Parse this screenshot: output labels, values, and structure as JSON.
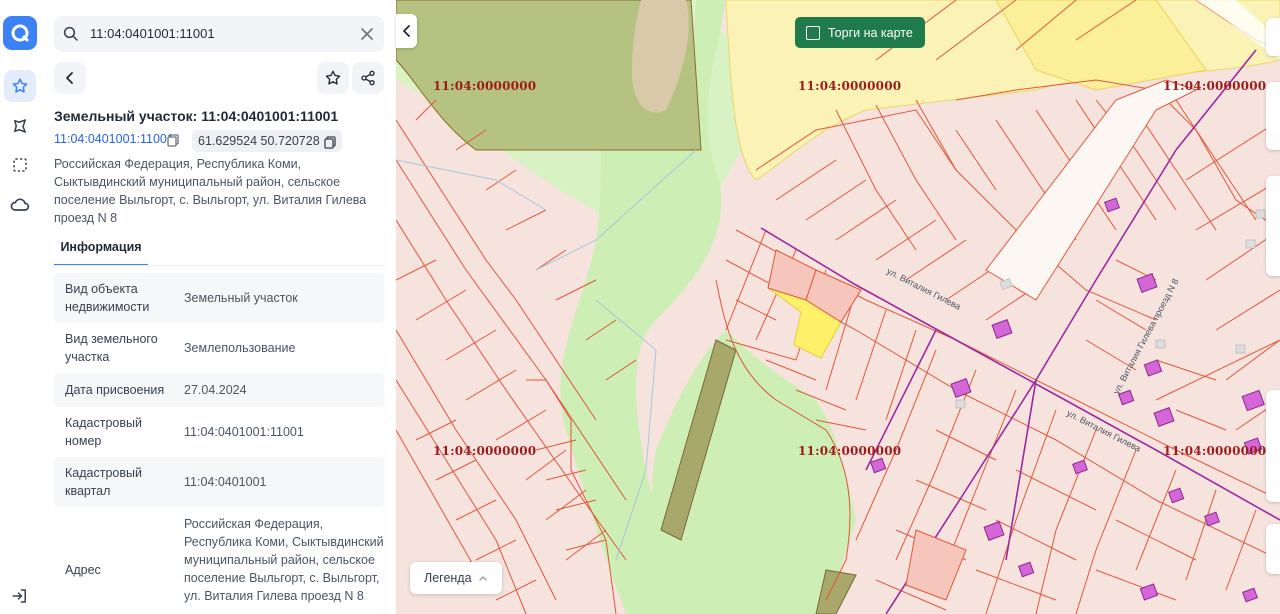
{
  "search": {
    "value": "11:04:0401001:11001"
  },
  "panel": {
    "title": "Земельный участок: 11:04:0401001:11001",
    "cad_link": "11:04:0401001:11001",
    "coords": "61.629524 50.720728",
    "address": "Российская Федерация, Республика Коми, Сыктывдинский муниципальный район, сельское поселение Выльгорт, с. Выльгорт, ул. Виталия Гилева проезд N 8",
    "tab_info": "Информация",
    "rows": [
      {
        "k": "Вид объекта недвижимости",
        "v": "Земельный участок"
      },
      {
        "k": "Вид земельного участка",
        "v": "Землепользование"
      },
      {
        "k": "Дата присвоения",
        "v": "27.04.2024"
      },
      {
        "k": "Кадастровый номер",
        "v": "11:04:0401001:11001"
      },
      {
        "k": "Кадастровый квартал",
        "v": "11:04:0401001"
      },
      {
        "k": "Адрес",
        "v": "Российская Федерация, Республика Коми, Сыктывдинский муниципальный район, сельское поселение Выльгорт, с. Выльгорт, ул. Виталия Гилева проезд N 8"
      }
    ]
  },
  "map": {
    "torgi_label": "Торги на карте",
    "legend_label": "Легенда",
    "quarter_labels": [
      "11:04:0000000",
      "11:04:0000000",
      "11:04:0000000",
      "11:04:0000000",
      "11:04:0000000",
      "11:04:0000000"
    ],
    "street_labels": [
      "ул. Виталия Гилева",
      "ул. Виталия Гилева",
      "ул. Виталия Гилева проезд N 8"
    ]
  },
  "colors": {
    "accent": "#3b82f6",
    "torgi": "#1f7a4c",
    "parcel_line": "#e0573a",
    "parcel_fill": "#f7e3de",
    "forest": "#d4f0bf",
    "selected": "#fff06a",
    "label": "#9e1b1b"
  },
  "icons": [
    "app-logo-icon",
    "star-icon",
    "route-icon",
    "select-area-icon",
    "cloud-icon",
    "logout-icon",
    "search-icon",
    "close-icon",
    "back-icon",
    "share-icon",
    "copy-icon",
    "chevron-left-icon",
    "chevron-up-icon"
  ]
}
